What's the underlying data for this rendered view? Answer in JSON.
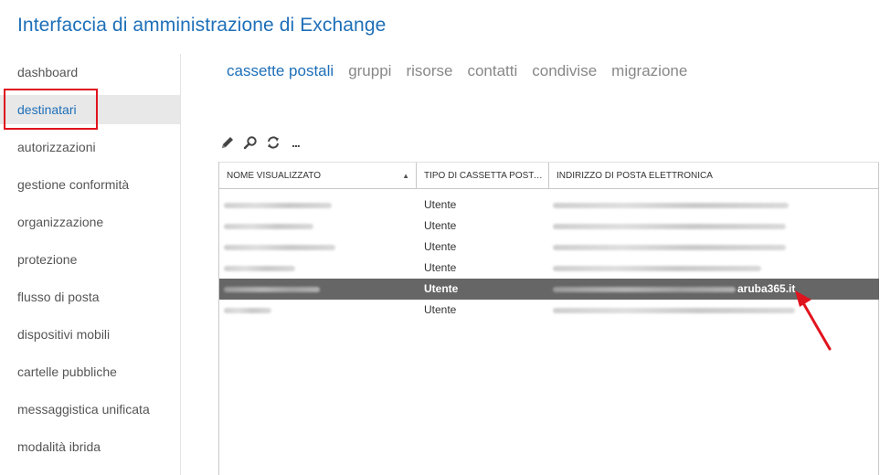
{
  "app": {
    "title": "Interfaccia di amministrazione di Exchange"
  },
  "sidebar": {
    "items": [
      {
        "label": "dashboard",
        "active": false
      },
      {
        "label": "destinatari",
        "active": true
      },
      {
        "label": "autorizzazioni",
        "active": false
      },
      {
        "label": "gestione conformità",
        "active": false
      },
      {
        "label": "organizzazione",
        "active": false
      },
      {
        "label": "protezione",
        "active": false
      },
      {
        "label": "flusso di posta",
        "active": false
      },
      {
        "label": "dispositivi mobili",
        "active": false
      },
      {
        "label": "cartelle pubbliche",
        "active": false
      },
      {
        "label": "messaggistica unificata",
        "active": false
      },
      {
        "label": "modalità ibrida",
        "active": false
      }
    ]
  },
  "tabs": [
    {
      "label": "cassette postali",
      "active": true
    },
    {
      "label": "gruppi",
      "active": false
    },
    {
      "label": "risorse",
      "active": false
    },
    {
      "label": "contatti",
      "active": false
    },
    {
      "label": "condivise",
      "active": false
    },
    {
      "label": "migrazione",
      "active": false
    }
  ],
  "toolbar": {
    "edit_icon": "pencil-icon",
    "search_icon": "search-icon",
    "refresh_icon": "refresh-icon",
    "more_icon": "more-icon",
    "more_label": "..."
  },
  "grid": {
    "columns": {
      "display_name": "NOME VISUALIZZATO",
      "mailbox_type": "TIPO DI CASSETTA POSTALE",
      "email": "INDIRIZZO DI POSTA ELETTRONICA"
    },
    "sort_indicator": "▲",
    "rows": [
      {
        "type": "Utente",
        "selected": false
      },
      {
        "type": "Utente",
        "selected": false
      },
      {
        "type": "Utente",
        "selected": false
      },
      {
        "type": "Utente",
        "selected": false
      },
      {
        "type": "Utente",
        "selected": true,
        "email_suffix": "aruba365.it"
      },
      {
        "type": "Utente",
        "selected": false
      }
    ]
  },
  "colors": {
    "accent": "#1e6fb8",
    "highlight_annotation": "#e0141e",
    "selected_row": "#666666"
  }
}
